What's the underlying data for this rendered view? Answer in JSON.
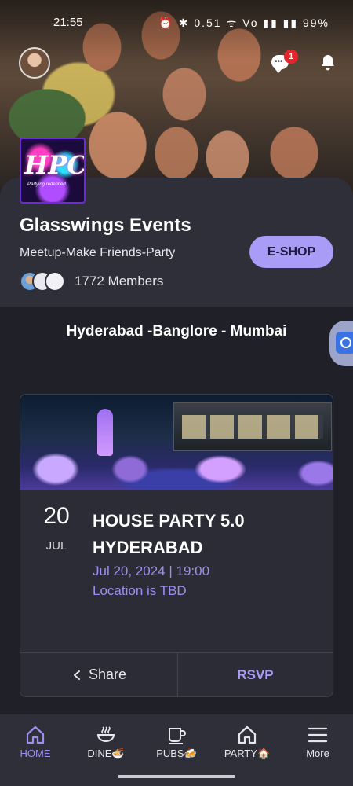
{
  "status_bar": {
    "time": "21:55",
    "icons_text": "⏰ ✱ 0.51 ᯤ Vo ▮▮ ▮▮ 99%",
    "battery": "99%"
  },
  "hero": {
    "notification_badge": "1"
  },
  "group": {
    "logo_text": "HPC",
    "logo_tagline": "Partying redefined",
    "name": "Glasswings Events",
    "tagline": "Meetup-Make Friends-Party",
    "members": "1772 Members",
    "eshop_label": "E-SHOP"
  },
  "cities": "Hyderabad -Banglore - Mumbai",
  "event": {
    "day": "20",
    "month": "JUL",
    "title": "HOUSE PARTY 5.0 HYDERABAD",
    "datetime": "Jul 20, 2024 | 19:00",
    "location": "Location is TBD",
    "share_label": "Share",
    "rsvp_label": "RSVP"
  },
  "bottom_nav": [
    {
      "label": "HOME",
      "icon": "home-icon",
      "active": true
    },
    {
      "label": "DINE🍜",
      "icon": "steaming-bowl-icon",
      "active": false
    },
    {
      "label": "PUBS🍻",
      "icon": "cup-icon",
      "active": false
    },
    {
      "label": "PARTY🏠",
      "icon": "home-icon",
      "active": false
    },
    {
      "label": "More",
      "icon": "menu-icon",
      "active": false
    }
  ],
  "colors": {
    "accent": "#a89cf6",
    "accent_text": "#9d8ff0",
    "background": "#202029",
    "surface": "#2f2f3a",
    "badge": "#e3262b"
  }
}
